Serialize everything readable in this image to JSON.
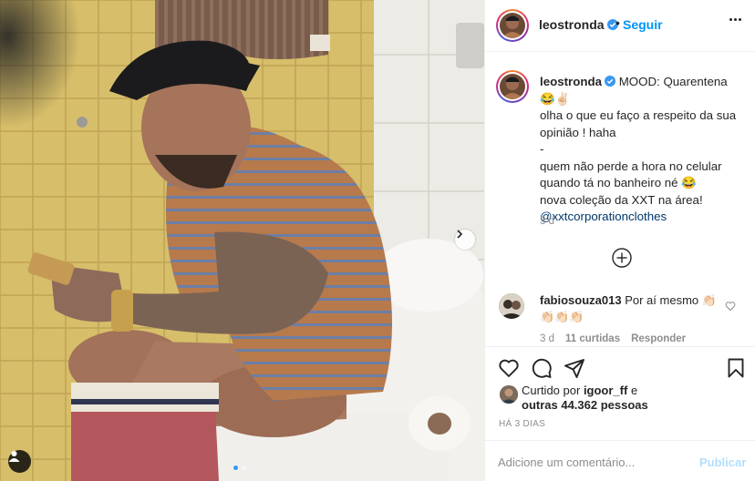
{
  "post": {
    "username": "leostronda",
    "separator": "•",
    "follow_label": "Seguir",
    "caption_text": "MOOD: Quarentena 😂✌🏻\nolha o que eu faço a respeito da sua opinião ! haha\n-\nquem não perde a hora no celular quando tá no banheiro né 😂\nnova coleção da XXT na área!",
    "caption_mention": "@xxtcorporationclothes",
    "caption_time": "3 d",
    "carousel": {
      "slides": 2,
      "active_index": 0
    }
  },
  "comment": {
    "username": "fabiosouza013",
    "text": "Por aí mesmo 👏🏻👏🏻👏🏻👏🏻",
    "time": "3 d",
    "likes": "11 curtidas",
    "reply_label": "Responder"
  },
  "likes": {
    "prefix": "Curtido por",
    "user": "igoor_ff",
    "connector": "e",
    "others": "outras 44.362 pessoas"
  },
  "date": "HÁ 3 DIAS",
  "add_comment": {
    "placeholder": "Adicione um comentário...",
    "publish_label": "Publicar"
  },
  "colors": {
    "accent": "#0095f6",
    "verified": "#3897f0",
    "publish_disabled": "#b2dffc",
    "muted": "#8e8e8e"
  },
  "icons": {
    "header_more": "more-horizontal-icon",
    "verified": "verified-badge-icon",
    "next": "chevron-right-icon",
    "tag": "user-tag-icon",
    "load_more": "plus-circle-icon",
    "like": "heart-icon",
    "comment": "comment-icon",
    "share": "send-icon",
    "save": "bookmark-icon"
  }
}
